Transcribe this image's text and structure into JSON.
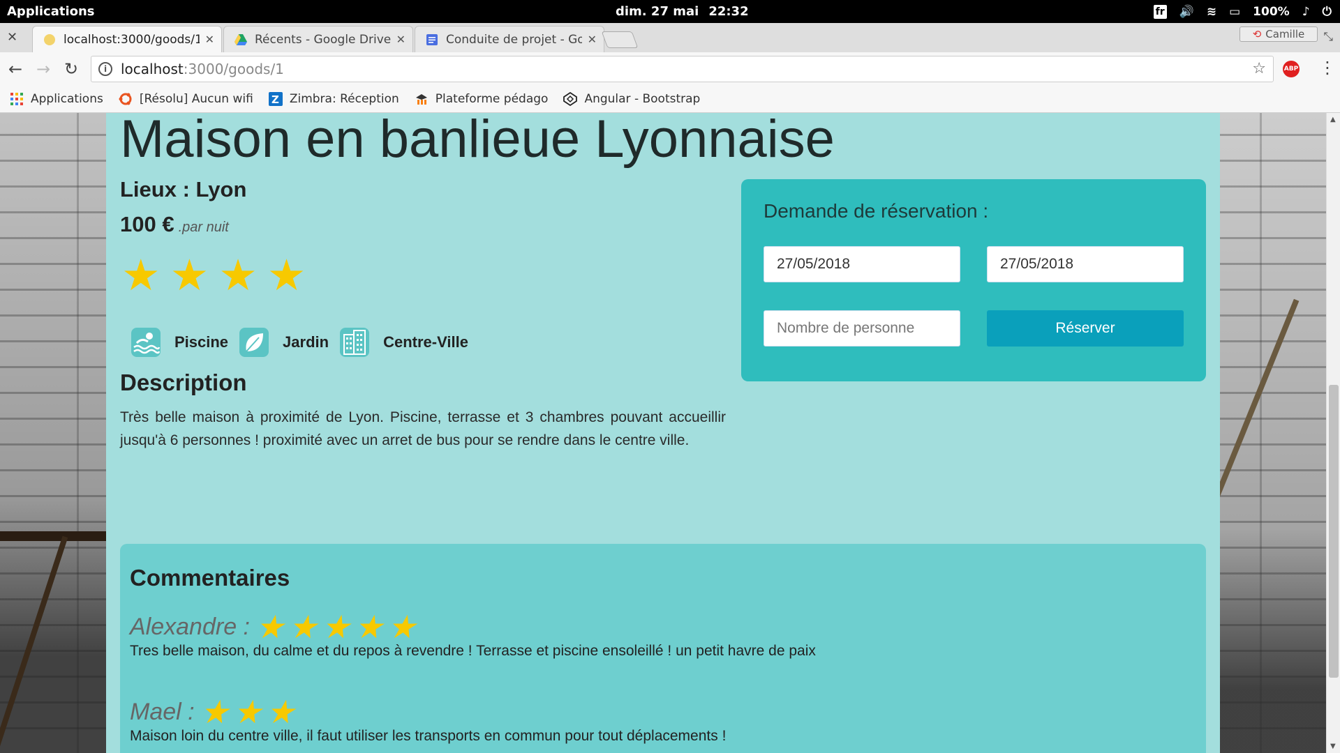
{
  "system_bar": {
    "apps_label": "Applications",
    "date": "dim. 27 mai",
    "time": "22:32",
    "keyboard": "fr",
    "battery": "100%"
  },
  "tabs": [
    {
      "title": "localhost:3000/goods/1",
      "active": true
    },
    {
      "title": "Récents - Google Drive",
      "active": false
    },
    {
      "title": "Conduite de projet - Go",
      "active": false
    }
  ],
  "profile_name": "Camille",
  "address": {
    "host": "localhost",
    "path": ":3000/goods/1"
  },
  "bookmarks": [
    {
      "label": "Applications",
      "icon": "apps-grid-icon"
    },
    {
      "label": "[Résolu] Aucun wifi",
      "icon": "ubuntu-icon"
    },
    {
      "label": "Zimbra: Réception",
      "icon": "zimbra-icon"
    },
    {
      "label": "Plateforme pédago",
      "icon": "moodle-icon"
    },
    {
      "label": "Angular - Bootstrap",
      "icon": "codepen-icon"
    }
  ],
  "listing": {
    "title": "Maison en banlieue Lyonnaise",
    "place": "Lieux : Lyon",
    "price": "100 €",
    "price_unit": ".par nuit",
    "rating": 4,
    "amenities": [
      {
        "label": "Piscine",
        "icon": "pool-icon"
      },
      {
        "label": "Jardin",
        "icon": "leaf-icon"
      },
      {
        "label": "Centre-Ville",
        "icon": "building-icon"
      }
    ],
    "description_heading": "Description",
    "description": "Très belle maison à proximité de Lyon. Piscine, terrasse et 3 chambres pouvant accueillir jusqu'à 6 personnes ! proximité avec un arret de bus pour se rendre dans le centre ville."
  },
  "reservation": {
    "title": "Demande de réservation :",
    "start_date": "27/05/2018",
    "end_date": "27/05/2018",
    "people_placeholder": "Nombre de personne",
    "button": "Réserver"
  },
  "comments": {
    "heading": "Commentaires",
    "items": [
      {
        "author": "Alexandre :",
        "rating": 5,
        "text": "Tres belle maison, du calme et du repos à revendre ! Terrasse et piscine ensoleillé ! un petit havre de paix"
      },
      {
        "author": "Mael :",
        "rating": 3,
        "text": "Maison loin du centre ville, il faut utiliser les transports en commun pour tout déplacements !"
      }
    ]
  },
  "colors": {
    "panel": "#a3dedd",
    "reservation_box": "#2fbdbd",
    "button": "#0aa0bb",
    "star": "#f7c900",
    "comments_box": "#6ecfcf"
  }
}
